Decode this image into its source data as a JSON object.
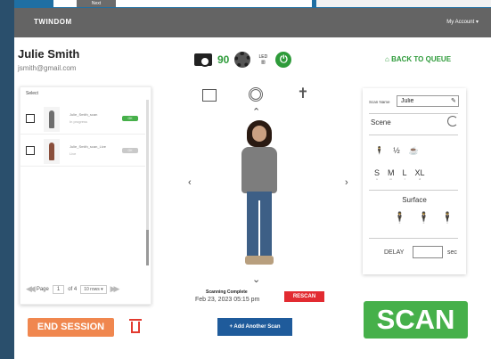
{
  "background": {
    "next_label": "Next"
  },
  "header": {
    "logo": "TWINDOM",
    "account": "My Account ▾"
  },
  "user": {
    "name": "Julie Smith",
    "email": "jsmith@gmail.com"
  },
  "status": {
    "photo_count": "90",
    "led_label": "LED"
  },
  "back_to_queue": "BACK TO QUEUE",
  "scan_list": {
    "select_label": "Select",
    "rows": [
      {
        "name": "Julie_Smith_scan",
        "sub": "In progress",
        "tag": "OK"
      },
      {
        "name": "Julie_Smith_scan_Live",
        "sub": "Live",
        "tag": "OK"
      }
    ],
    "pager": {
      "page_label": "Page",
      "page": "1",
      "of_label": "of 4",
      "rows": "10 rows ▾"
    }
  },
  "end_session": "END SESSION",
  "preview": {
    "complete_label": "Scanning Complete",
    "date": "Feb 23, 2023 05:15 pm",
    "rescan": "RESCAN"
  },
  "add_scan": "+ Add Another Scan",
  "settings": {
    "scan_name_label": "Scan Name",
    "scan_name_value": "Julie",
    "scene_label": "Scene",
    "poses": [
      "🕴",
      "½",
      "☕"
    ],
    "sizes": [
      {
        "letter": "S",
        "sub": "s"
      },
      {
        "letter": "M",
        "sub": "m"
      },
      {
        "letter": "L",
        "sub": "l"
      },
      {
        "letter": "XL",
        "sub": "xl"
      }
    ],
    "surface_label": "Surface",
    "delay_label": "DELAY",
    "delay_unit": "sec"
  },
  "scan_button": "SCAN",
  "colors": {
    "accent_green": "#46b04a",
    "brand_blue": "#1f5b9b",
    "rescan_red": "#e22b31",
    "end_orange": "#f0874f",
    "topbar": "#646464"
  }
}
